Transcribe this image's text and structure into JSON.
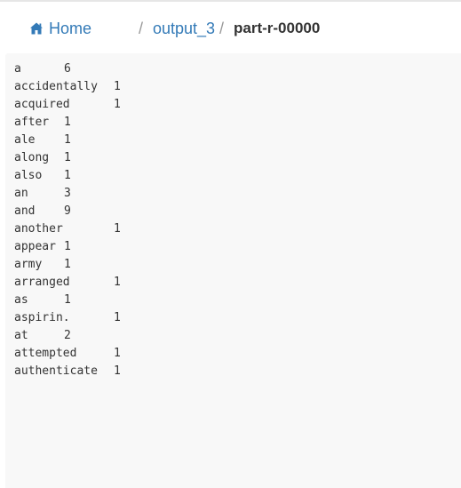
{
  "breadcrumb": {
    "home_label": "Home",
    "separator": "/",
    "folder_label": "output_3",
    "file_label": "part-r-00000"
  },
  "icons": {
    "home": "home-icon"
  },
  "colors": {
    "link": "#337ab7",
    "active": "#333333",
    "panel_bg": "#f8f8f8"
  },
  "file": {
    "lines": [
      {
        "word": "a",
        "count": "6"
      },
      {
        "word": "accidentally",
        "count": "1"
      },
      {
        "word": "acquired",
        "count": "1"
      },
      {
        "word": "after",
        "count": "1"
      },
      {
        "word": "ale",
        "count": "1"
      },
      {
        "word": "along",
        "count": "1"
      },
      {
        "word": "also",
        "count": "1"
      },
      {
        "word": "an",
        "count": "3"
      },
      {
        "word": "and",
        "count": "9"
      },
      {
        "word": "another",
        "count": "1"
      },
      {
        "word": "appear",
        "count": "1"
      },
      {
        "word": "army",
        "count": "1"
      },
      {
        "word": "arranged",
        "count": "1"
      },
      {
        "word": "as",
        "count": "1"
      },
      {
        "word": "aspirin.",
        "count": "1"
      },
      {
        "word": "at",
        "count": "2"
      },
      {
        "word": "attempted",
        "count": "1"
      },
      {
        "word": "authenticate",
        "count": "1"
      }
    ]
  }
}
